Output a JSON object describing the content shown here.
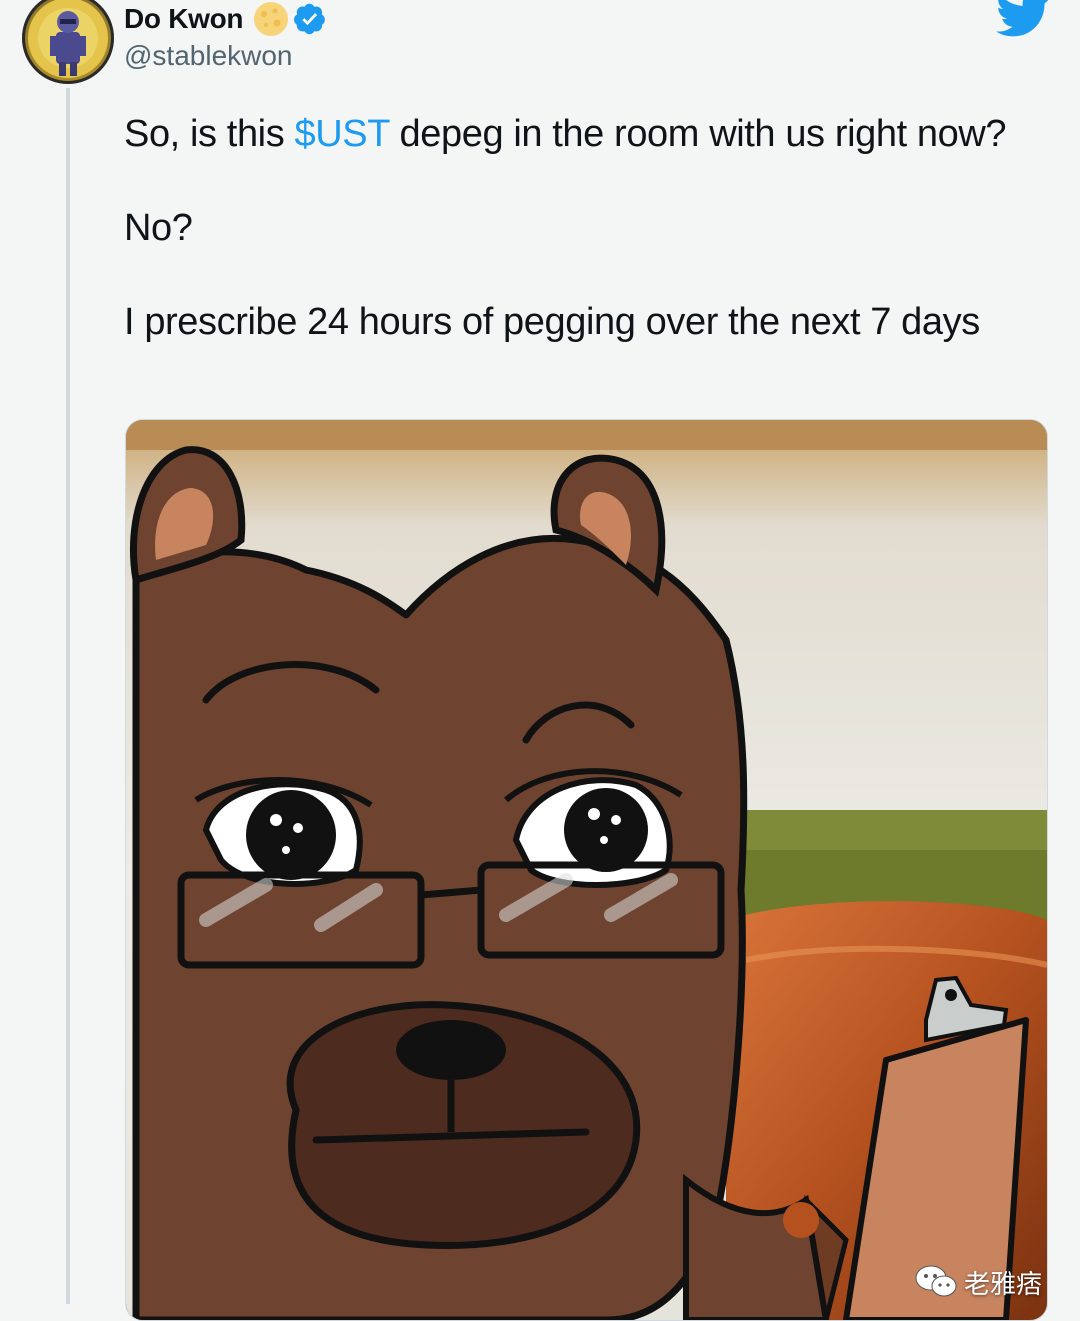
{
  "tweet": {
    "author": {
      "display_name": "Do Kwon",
      "handle": "@stablekwon",
      "badges": [
        "moon-icon",
        "verified-icon"
      ]
    },
    "text": {
      "line1_before": "So, is this ",
      "cashtag": "$UST",
      "line1_after": " depeg in the room with us right now?",
      "line2": "No?",
      "line3": "I prescribe 24 hours of pegging over the next 7 days"
    },
    "media": {
      "type": "image",
      "icons": [
        "bear-glasses-meme"
      ]
    }
  },
  "watermark": {
    "label": "老雅痞",
    "icon": "wechat-icon"
  },
  "colors": {
    "accent": "#1d9bf0",
    "text": "#0f1419",
    "secondary_text": "#536471",
    "background": "#f4f5f5"
  }
}
